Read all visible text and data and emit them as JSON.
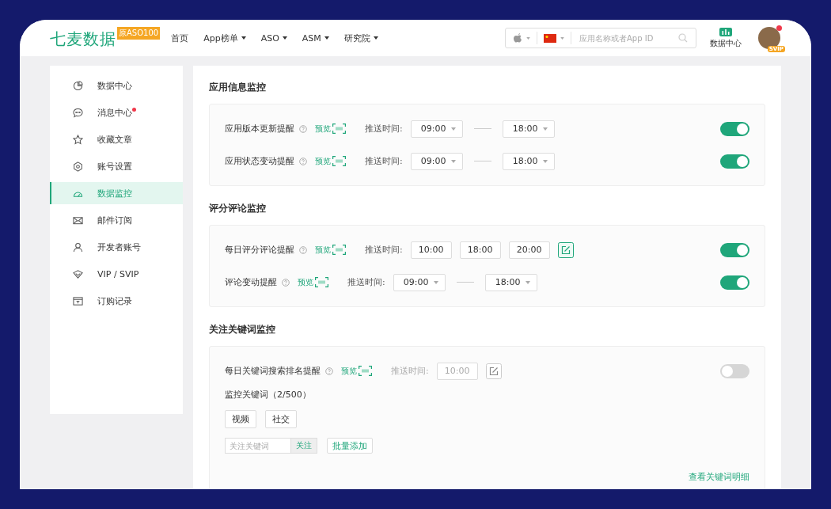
{
  "header": {
    "logo": "七麦数据",
    "logo_badge": "原ASO100",
    "nav": [
      {
        "label": "首页",
        "dropdown": false
      },
      {
        "label": "App榜单",
        "dropdown": true
      },
      {
        "label": "ASO",
        "dropdown": true
      },
      {
        "label": "ASM",
        "dropdown": true
      },
      {
        "label": "研究院",
        "dropdown": true
      }
    ],
    "search": {
      "placeholder": "应用名称或者App ID"
    },
    "data_center": "数据中心",
    "vip_badge": "SVIP"
  },
  "sidebar": {
    "items": [
      {
        "label": "数据中心",
        "selected": false,
        "dot": false
      },
      {
        "label": "消息中心",
        "selected": false,
        "dot": true
      },
      {
        "label": "收藏文章",
        "selected": false,
        "dot": false
      },
      {
        "label": "账号设置",
        "selected": false,
        "dot": false
      },
      {
        "label": "数据监控",
        "selected": true,
        "dot": false
      },
      {
        "label": "邮件订阅",
        "selected": false,
        "dot": false
      },
      {
        "label": "开发者账号",
        "selected": false,
        "dot": false
      },
      {
        "label": "VIP / SVIP",
        "selected": false,
        "dot": false
      },
      {
        "label": "订购记录",
        "selected": false,
        "dot": false
      }
    ]
  },
  "sections": [
    {
      "title": "应用信息监控",
      "rows": [
        {
          "kind": "range",
          "label": "应用版本更新提醒",
          "preview": "预览",
          "time_label": "推送时间:",
          "times": [
            "09:00",
            "18:00"
          ],
          "on": true
        },
        {
          "kind": "range",
          "label": "应用状态变动提醒",
          "preview": "预览",
          "time_label": "推送时间:",
          "times": [
            "09:00",
            "18:00"
          ],
          "on": true
        }
      ]
    },
    {
      "title": "评分评论监控",
      "rows": [
        {
          "kind": "fixed",
          "label": "每日评分评论提醒",
          "preview": "预览",
          "time_label": "推送时间:",
          "times": [
            "10:00",
            "18:00",
            "20:00"
          ],
          "on": true
        },
        {
          "kind": "range",
          "label": "评论变动提醒",
          "preview": "预览",
          "time_label": "推送时间:",
          "times": [
            "09:00",
            "18:00"
          ],
          "on": true
        }
      ]
    },
    {
      "title": "关注关键词监控",
      "rows": [
        {
          "kind": "fixed",
          "label": "每日关键词搜索排名提醒",
          "preview": "预览",
          "time_label": "推送时间:",
          "times": [
            "10:00"
          ],
          "on": false
        }
      ],
      "keywords": {
        "label": "监控关键词（2/500）",
        "tags": [
          "视频",
          "社交"
        ],
        "placeholder": "关注关键词",
        "follow": "关注",
        "bulk_add": "批量添加",
        "details_link": "查看关键词明细"
      }
    }
  ]
}
